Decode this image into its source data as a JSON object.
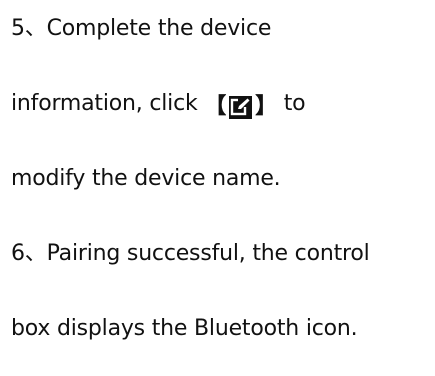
{
  "step5": {
    "line1": "5、Complete the device",
    "line2_before": "information, click ",
    "bracket_open": "【",
    "icon": "edit-icon",
    "bracket_close": "】",
    "line2_after": " to",
    "line3": "modify the device name."
  },
  "step6": {
    "line1": "6、Pairing successful, the control",
    "line2": "box displays the Bluetooth icon."
  }
}
